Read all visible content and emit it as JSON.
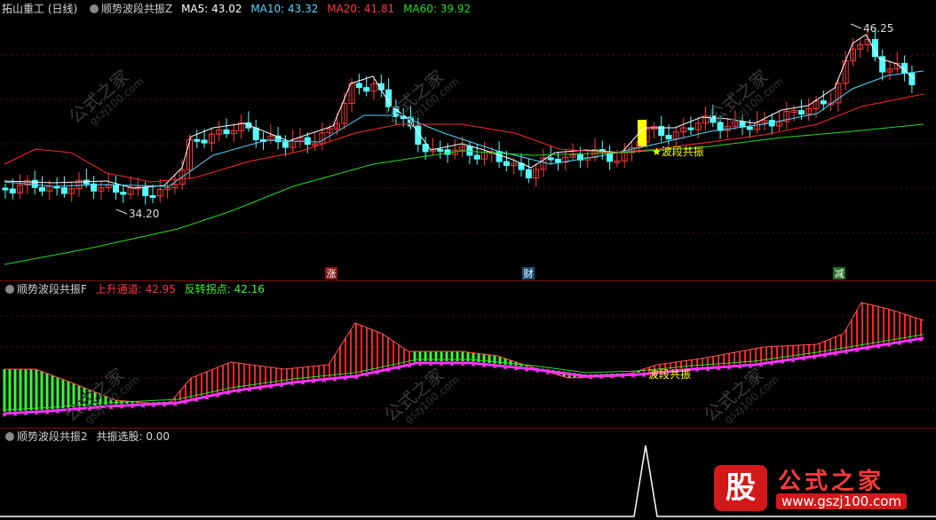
{
  "panel1": {
    "stock_name": "拓山重工 (日线)",
    "indicator": "顺势波段共振Z",
    "ma5": "MA5: 43.02",
    "ma10": "MA10: 43.32",
    "ma20": "MA20: 41.81",
    "ma60": "MA60: 39.92",
    "label_high": "46.25",
    "label_low": "34.20",
    "signal_label": "波段共振",
    "markers": [
      "涨",
      "财",
      "减"
    ],
    "colors": {
      "up": "#ff3a3a",
      "down": "#54ffff",
      "ma5": "#ffffff",
      "ma10": "#54d8ff",
      "ma20": "#ff2a2a",
      "ma60": "#22dd22",
      "signal": "#ffff00"
    }
  },
  "panel2": {
    "indicator": "顺势波段共振F",
    "up_channel": "上升通道: 42.95",
    "turn_point": "反转拐点: 42.16",
    "signal_label": "波段共振",
    "colors": {
      "up_hist": "#ff2222",
      "down_hist": "#33ff33",
      "channel_line": "#ff33ff",
      "star": "#ff33ff"
    }
  },
  "panel3": {
    "indicator": "顺势波段共振2",
    "value": "共振选股: 0.00",
    "color_line": "#ffffff"
  },
  "watermark": {
    "text": "公式之家",
    "url": "gszj100.com"
  },
  "logo": {
    "badge": "股",
    "title": "公式之家",
    "url": "www.gszj100.com"
  },
  "chart_data": [
    {
      "type": "candlestick",
      "title": "拓山重工 (日线)",
      "annotations": [
        "46.25",
        "34.20",
        "波段共振"
      ],
      "series": [
        {
          "name": "MA5",
          "last": 43.02
        },
        {
          "name": "MA10",
          "last": 43.32
        },
        {
          "name": "MA20",
          "last": 41.81
        },
        {
          "name": "MA60",
          "last": 39.92
        }
      ],
      "ylim": [
        34.2,
        46.25
      ]
    },
    {
      "type": "bar",
      "title": "顺势波段共振F",
      "series": [
        {
          "name": "上升通道",
          "last": 42.95
        },
        {
          "name": "反转拐点",
          "last": 42.16
        }
      ]
    },
    {
      "type": "line",
      "title": "顺势波段共振2",
      "series": [
        {
          "name": "共振选股",
          "last": 0.0
        }
      ]
    }
  ]
}
